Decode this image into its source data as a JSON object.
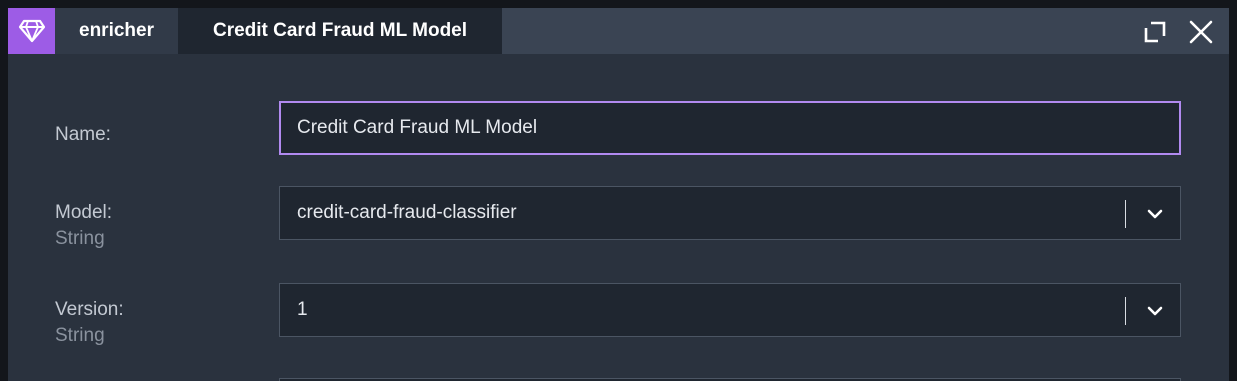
{
  "titlebar": {
    "node_icon": "diamond-icon",
    "node_type": "enricher",
    "tab_title": "Credit Card Fraud ML Model",
    "maximize_icon": "maximize-icon",
    "close_icon": "close-icon"
  },
  "form": {
    "name": {
      "label": "Name:",
      "value": "Credit Card Fraud ML Model"
    },
    "model": {
      "label": "Model:",
      "type": "String",
      "value": "credit-card-fraud-classifier"
    },
    "version": {
      "label": "Version:",
      "type": "String",
      "value": "1"
    }
  },
  "colors": {
    "accent": "#9d5ce6",
    "focus_border": "#b18af0",
    "panel_bg": "#2a323e",
    "input_bg": "#1f2630"
  }
}
